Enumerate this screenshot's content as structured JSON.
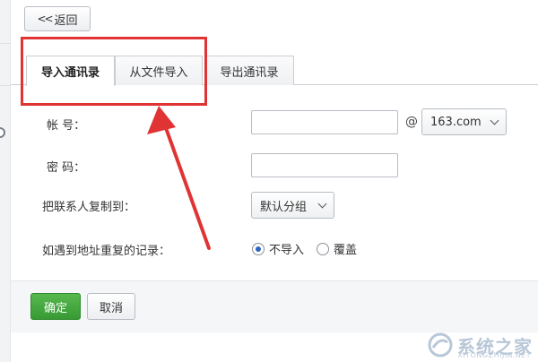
{
  "nav": {
    "back_label": "返回",
    "back_chevron": "<<"
  },
  "tabs": [
    {
      "label": "导入通讯录",
      "active": true
    },
    {
      "label": "从文件导入",
      "active": false
    },
    {
      "label": "导出通讯录",
      "active": false
    }
  ],
  "form": {
    "account_label": "帐 号：",
    "account_value": "",
    "at_sign": "@",
    "domain_selected": "163.com",
    "password_label": "密 码：",
    "password_value": "",
    "copy_label": "把联系人复制到：",
    "group_selected": "默认分组",
    "duplicate_label": "如遇到地址重复的记录：",
    "duplicate_options": [
      {
        "label": "不导入",
        "checked": true
      },
      {
        "label": "覆盖",
        "checked": false
      }
    ]
  },
  "actions": {
    "confirm_label": "确定",
    "cancel_label": "取消"
  },
  "colors": {
    "highlight": "#e03434",
    "confirm": "#44a83f",
    "radio": "#2a66c2"
  },
  "watermark": {
    "text": "系统之家",
    "sub": "XITONGZHIJIA.NET",
    "icon": "logo-icon"
  }
}
